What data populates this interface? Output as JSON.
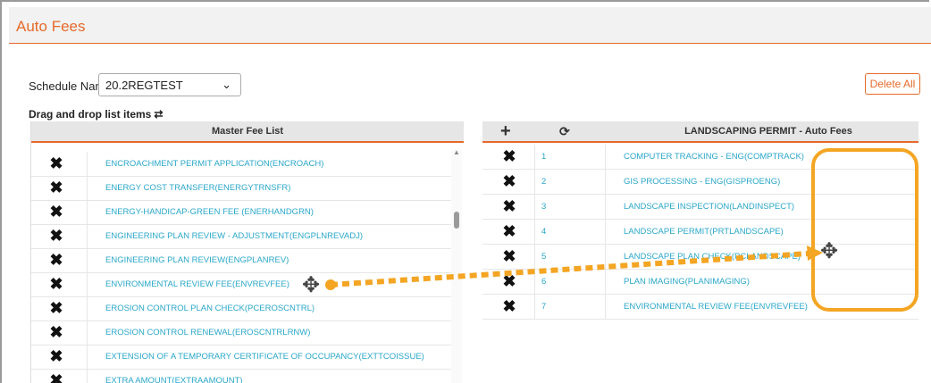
{
  "header": {
    "title": "Auto Fees"
  },
  "schedule": {
    "label": "Schedule Name:",
    "value": "20.2REGTEST"
  },
  "toolbar": {
    "delete_all": "Delete All"
  },
  "dnd": {
    "label": "Drag and drop list items",
    "swap_icon": "⇄"
  },
  "master": {
    "header": "Master Fee List",
    "items": [
      {
        "name": "ENCROACHMENT PERMIT APPLICATION(ENCROACH)"
      },
      {
        "name": "ENERGY COST TRANSFER(ENERGYTRNSFR)"
      },
      {
        "name": "ENERGY-HANDICAP-GREEN FEE (ENERHANDGRN)"
      },
      {
        "name": "ENGINEERING PLAN REVIEW - ADJUSTMENT(ENGPLNREVADJ)"
      },
      {
        "name": "ENGINEERING PLAN REVIEW(ENGPLANREV)"
      },
      {
        "name": "ENVIRONMENTAL REVIEW FEE(ENVREVFEE)"
      },
      {
        "name": "EROSION CONTROL PLAN CHECK(PCEROSCNTRL)"
      },
      {
        "name": "EROSION CONTROL RENEWAL(EROSCNTRLRNW)"
      },
      {
        "name": "EXTENSION OF A TEMPORARY CERTIFICATE OF OCCUPANCY(EXTTCOISSUE)"
      },
      {
        "name": "EXTRA AMOUNT(EXTRAAMOUNT)"
      }
    ]
  },
  "auto_fees": {
    "header": "LANDSCAPING PERMIT - Auto Fees",
    "add_icon": "plus-icon",
    "refresh_icon": "refresh-icon",
    "items": [
      {
        "num": "1",
        "name": "COMPUTER TRACKING - ENG(COMPTRACK)"
      },
      {
        "num": "2",
        "name": "GIS PROCESSING - ENG(GISPROENG)"
      },
      {
        "num": "3",
        "name": "LANDSCAPE INSPECTION(LANDINSPECT)"
      },
      {
        "num": "4",
        "name": "LANDSCAPE PERMIT(PRTLANDSCAPE)"
      },
      {
        "num": "5",
        "name": "LANDSCAPE PLAN CHECK(PCLANDSCAPE)"
      },
      {
        "num": "6",
        "name": "PLAN IMAGING(PLANIMAGING)"
      },
      {
        "num": "7",
        "name": "ENVIRONMENTAL REVIEW FEE(ENVREVFEE)"
      }
    ]
  },
  "colors": {
    "accent": "#e56a2b",
    "link": "#2aa7c9",
    "highlight": "#f4a523"
  }
}
